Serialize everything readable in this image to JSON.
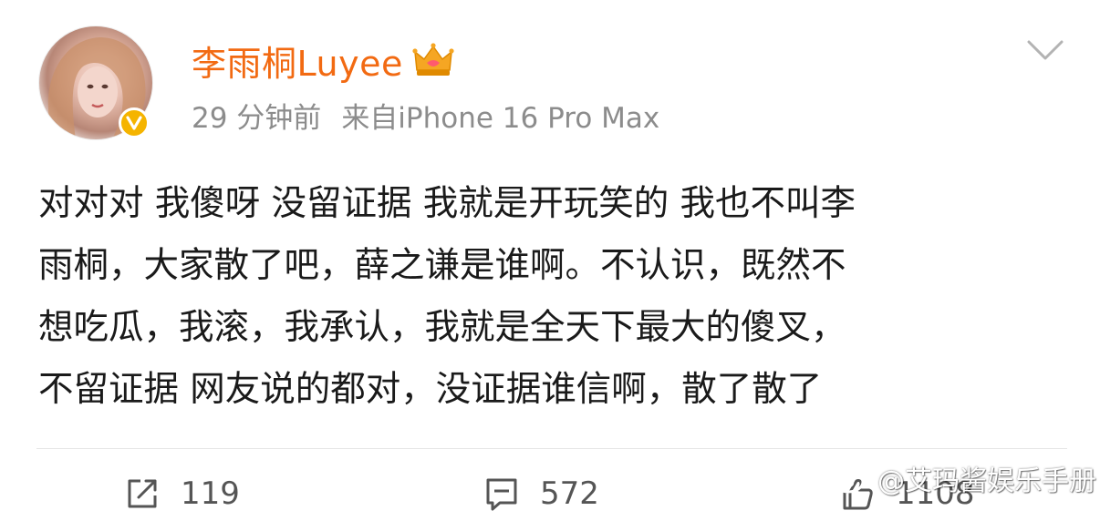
{
  "post": {
    "author": {
      "name": "李雨桐Luyee",
      "verified": true,
      "verified_badge_color": "#f5b400",
      "name_color": "#f26a12",
      "membership_icon": "crown-icon"
    },
    "meta": {
      "time": "29 分钟前",
      "source": "来自iPhone 16 Pro Max"
    },
    "menu_icon": "chevron-down-icon",
    "content_lines": [
      "对对对 我傻呀 没留证据 我就是开玩笑的 我也不叫李",
      "雨桐，大家散了吧，薛之谦是谁啊。不认识，既然不",
      "想吃瓜，我滚，我承认，我就是全天下最大的傻叉，",
      "不留证据 网友说的都对，没证据谁信啊，散了散了"
    ],
    "actions": {
      "repost": {
        "icon": "repost-icon",
        "count": "119"
      },
      "comment": {
        "icon": "comment-icon",
        "count": "572"
      },
      "like": {
        "icon": "like-icon",
        "count": "1108"
      }
    }
  },
  "watermark": {
    "icon": "weibo-logo-icon",
    "text": "@艾玛酱娱乐手册"
  }
}
